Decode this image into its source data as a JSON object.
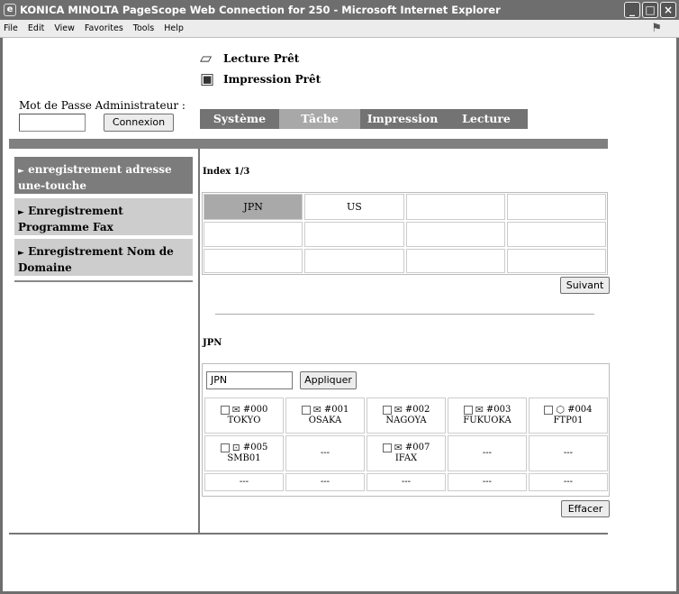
{
  "window": {
    "title": "KONICA MINOLTA PageScope Web Connection for 250 - Microsoft Internet Explorer",
    "buttons": [
      "_",
      "□",
      "×"
    ]
  },
  "menu": [
    "File",
    "Edit",
    "View",
    "Favorites",
    "Tools",
    "Help"
  ],
  "status": {
    "scanner": "Lecture Prêt",
    "printer": "Impression Prêt"
  },
  "admin": {
    "label": "Mot de Passe Administrateur :",
    "password_value": "",
    "login_button": "Connexion"
  },
  "tabs": [
    "Système",
    "Tâche",
    "Impression",
    "Lecture"
  ],
  "sidebar": {
    "items": [
      {
        "label": "enregistrement adresse une-touche",
        "arrow": "►",
        "active": true
      },
      {
        "label": "Enregistrement Programme Fax",
        "arrow": "►",
        "active": false
      },
      {
        "label": "Enregistrement Nom de Domaine",
        "arrow": "►",
        "active": false
      }
    ]
  },
  "index": {
    "label": "Index 1/3",
    "cells": [
      "JPN",
      "US",
      "",
      "",
      "",
      "",
      "",
      "",
      "",
      "",
      "",
      ""
    ],
    "selected": "JPN",
    "next_button": "Suivant"
  },
  "group": {
    "label": "JPN",
    "name_value": "JPN",
    "apply_button": "Appliquer",
    "clear_button": "Effacer",
    "destinations": [
      {
        "number": "#000",
        "name": "TOKYO",
        "icon": "email-icon"
      },
      {
        "number": "#001",
        "name": "OSAKA",
        "icon": "email-icon"
      },
      {
        "number": "#002",
        "name": "NAGOYA",
        "icon": "email-icon"
      },
      {
        "number": "#003",
        "name": "FUKUOKA",
        "icon": "email-icon"
      },
      {
        "number": "#004",
        "name": "FTP01",
        "icon": "ftp-icon"
      },
      {
        "number": "#005",
        "name": "SMB01",
        "icon": "smb-icon"
      },
      {
        "empty": "---"
      },
      {
        "number": "#007",
        "name": "IFAX",
        "icon": "email-icon"
      },
      {
        "empty": "---"
      },
      {
        "empty": "---"
      },
      {
        "empty": "---"
      },
      {
        "empty": "---"
      },
      {
        "empty": "---"
      },
      {
        "empty": "---"
      },
      {
        "empty": "---"
      }
    ]
  },
  "colors": {
    "tab_active": "#a8a8a8",
    "tab": "#737373",
    "sidebar_active": "#7c7c7c",
    "sidebar": "#cdcdcd",
    "selected_index": "#a9a9a9"
  }
}
